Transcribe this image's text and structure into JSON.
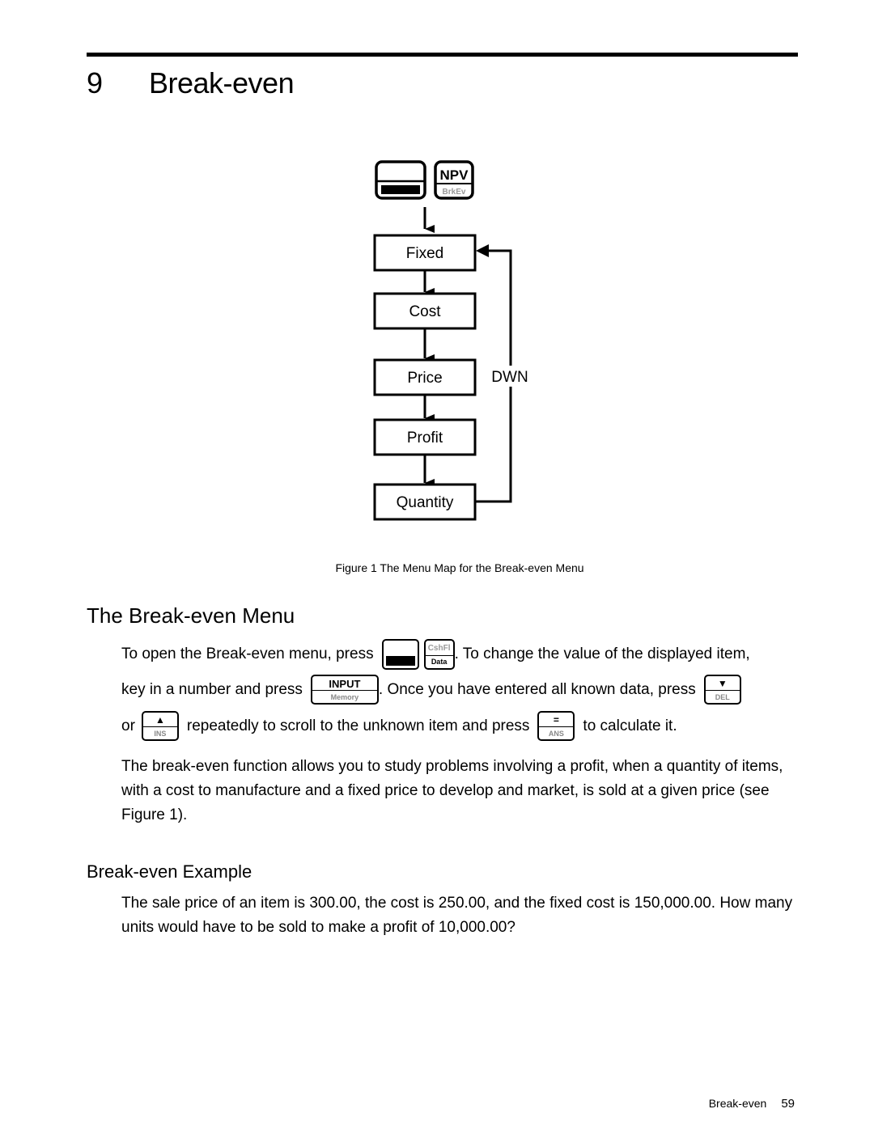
{
  "chapter": {
    "number": "9",
    "title": "Break-even"
  },
  "figure": {
    "keys": [
      {
        "name": "shift-key",
        "top": "",
        "bottom": ""
      },
      {
        "name": "npv-key",
        "top": "NPV",
        "bottom": "BrkEv"
      }
    ],
    "menu_items": [
      "Fixed",
      "Cost",
      "Price",
      "Profit",
      "Quantity"
    ],
    "loop_label": "DWN",
    "caption": "Figure 1  The Menu Map for the Break-even Menu"
  },
  "section_menu": {
    "heading": "The Break-even Menu",
    "line1_a": "To open the Break-even menu, press",
    "line1_b": ". To change the value of the displayed item,",
    "line2_a": "key in a number and press",
    "line2_b": ". Once you have entered all known data, press",
    "line3_a": "or",
    "line3_b": "repeatedly to scroll to the unknown item and press",
    "line3_c": "to calculate it.",
    "keys": {
      "cashfl_top": "CshFl",
      "cashfl_bottom": "Data",
      "input_top": "INPUT",
      "input_bottom": "Memory",
      "down_top": "▼",
      "down_bottom": "DEL",
      "up_top": "▲",
      "up_bottom": "INS",
      "equals_top": "=",
      "equals_bottom": "ANS"
    },
    "paragraph": "The break-even function allows you to study problems involving a profit, when a quantity of items, with a cost to manufacture and a fixed price to develop and market, is sold at a given price (see Figure 1)."
  },
  "section_example": {
    "heading": "Break-even Example",
    "paragraph": "The sale price of an item is 300.00, the cost is 250.00, and the fixed cost is 150,000.00. How many units would have to be sold to make a profit of 10,000.00?"
  },
  "footer": {
    "section": "Break-even",
    "page": "59"
  }
}
